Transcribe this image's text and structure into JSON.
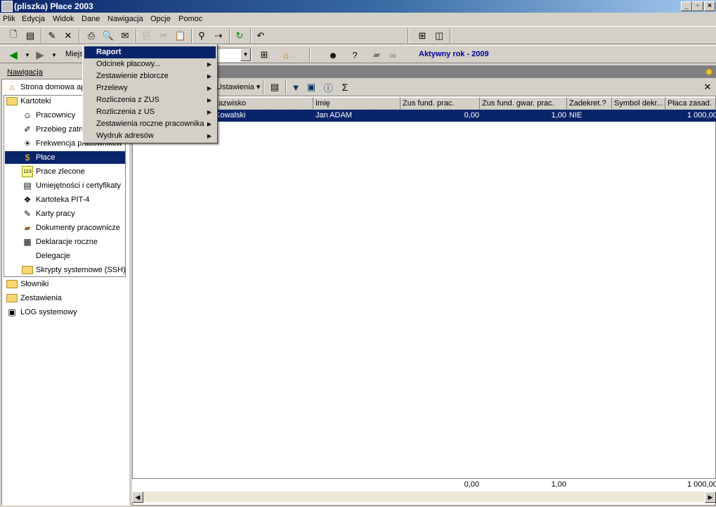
{
  "window": {
    "title": "(pliszka)  Płace 2003"
  },
  "menu": [
    "Plik",
    "Edycja",
    "Widok",
    "Dane",
    "Nawigacja",
    "Opcje",
    "Pomoc"
  ],
  "toolbar2": {
    "location_label": "Miejs",
    "active_year": "Aktywny rok - 2009"
  },
  "nav": {
    "header": "Nawigacja",
    "home": "Strona domowa ap",
    "kartoteki": "Kartoteki",
    "items": [
      "Pracownicy",
      "Przebieg zatru",
      "Frekwencja pracowników",
      "Płace",
      "Prace zlecone",
      "Umiejętności i certyfikaty",
      "Kartoteka PIT-4",
      "Karty pracy",
      "Dokumenty pracownicze",
      "Deklaracje roczne",
      "Delegacje",
      "Skrypty systemowe (SSH)"
    ],
    "bottom": [
      "Słowniki",
      "Zestawienia",
      "LOG systemowy"
    ]
  },
  "right_toolbar": {
    "settings_label": "Ustawienia"
  },
  "grid": {
    "columns": [
      "Nazwisko",
      "Imię",
      "Zus fund. prac.",
      "Zus fund. gwar. prac.",
      "Zadekret.?",
      "Symbol dekr...",
      "Płaca zasad."
    ],
    "row": {
      "nazwisko": "Kowalski",
      "imie": "Jan ADAM",
      "zus_fund": "0,00",
      "zus_gwar": "1,00",
      "zadekret": "NIE",
      "placa": "1 000,00"
    },
    "footer": {
      "zus_fund": "0,00",
      "zus_gwar": "1,00",
      "placa": "1 000,00"
    }
  },
  "popup": {
    "items": [
      {
        "label": "Raport",
        "submenu": false
      },
      {
        "label": "Odcinek płacowy...",
        "submenu": true
      },
      {
        "label": "Zestawienie zbiorcze",
        "submenu": true
      },
      {
        "label": "Przelewy",
        "submenu": true
      },
      {
        "label": "Rozliczenia z ZUS",
        "submenu": true
      },
      {
        "label": "Rozliczenia z US",
        "submenu": true
      },
      {
        "label": "Zestawienia roczne pracownika",
        "submenu": true
      },
      {
        "label": "Wydruk adresów",
        "submenu": true
      }
    ]
  },
  "colors": {
    "selection": "#0a246a",
    "accent_year": "#0000a0"
  }
}
